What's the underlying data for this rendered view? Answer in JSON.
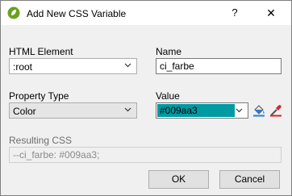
{
  "dialog": {
    "title": "Add New CSS Variable",
    "help_glyph": "?",
    "close_glyph": "✕"
  },
  "form": {
    "html_element": {
      "label": "HTML Element",
      "value": ":root"
    },
    "name": {
      "label": "Name",
      "value": "ci_farbe"
    },
    "property_type": {
      "label": "Property Type",
      "value": "Color"
    },
    "value": {
      "label": "Value",
      "value": "#009aa3",
      "swatch_color": "#009aa3"
    },
    "resulting_css": {
      "label": "Resulting CSS",
      "value": "--ci_farbe: #009aa3;"
    }
  },
  "buttons": {
    "ok": "OK",
    "cancel": "Cancel"
  },
  "icons": {
    "app": "app-logo-icon",
    "fill": "paint-bucket-icon",
    "picker": "eyedropper-icon"
  },
  "colors": {
    "accent": "#009aa3",
    "titlebar": "#ffffff",
    "window": "#f0f0f0"
  }
}
